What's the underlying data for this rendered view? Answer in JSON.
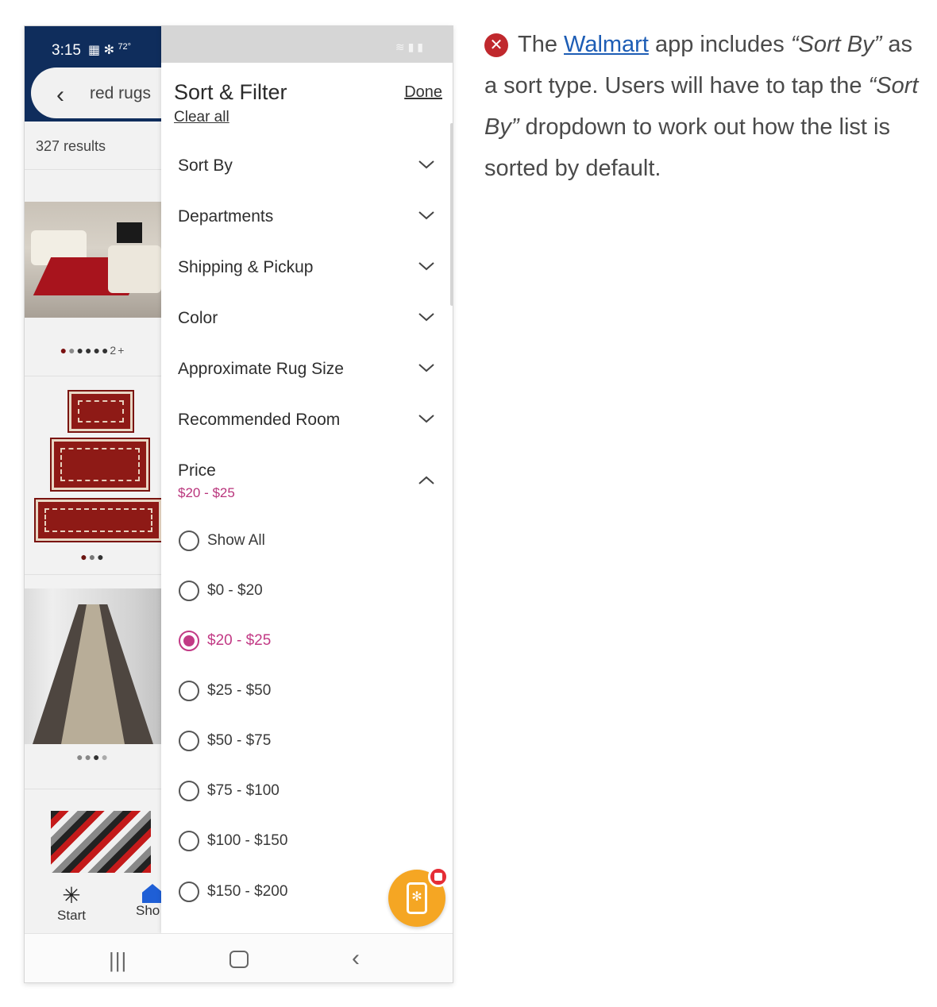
{
  "status_bar": {
    "time": "3:15",
    "temperature": "72°"
  },
  "background_app": {
    "search_query": "red rugs",
    "results_count": "327 results",
    "bottom_nav": {
      "start_label": "Start",
      "shop_label": "Sho"
    },
    "more_colors_badge": "2+"
  },
  "panel": {
    "title": "Sort & Filter",
    "done_label": "Done",
    "clear_all_label": "Clear all",
    "sections": [
      {
        "label": "Sort By"
      },
      {
        "label": "Departments"
      },
      {
        "label": "Shipping & Pickup"
      },
      {
        "label": "Color"
      },
      {
        "label": "Approximate Rug Size"
      },
      {
        "label": "Recommended Room"
      },
      {
        "label": "Price"
      }
    ],
    "price_selected": "$20 - $25",
    "price_options": [
      {
        "label": "Show All",
        "selected": false
      },
      {
        "label": "$0 - $20",
        "selected": false
      },
      {
        "label": "$20 - $25",
        "selected": true
      },
      {
        "label": "$25 - $50",
        "selected": false
      },
      {
        "label": "$50 - $75",
        "selected": false
      },
      {
        "label": "$75 - $100",
        "selected": false
      },
      {
        "label": "$100 - $150",
        "selected": false
      },
      {
        "label": "$150 - $200",
        "selected": false
      }
    ]
  },
  "note": {
    "part1": "The ",
    "link": "Walmart",
    "part2": " app includes ",
    "em1": "“Sort By”",
    "part3": " as a sort type. Users will have to tap the ",
    "em2": "“Sort By”",
    "part4": " dropdown to work out how the list is sorted by default."
  },
  "colors": {
    "accent": "#c23a85",
    "header": "#0f2d5c",
    "fab": "#f5a623",
    "error": "#c0282d",
    "link": "#1d5db5"
  }
}
